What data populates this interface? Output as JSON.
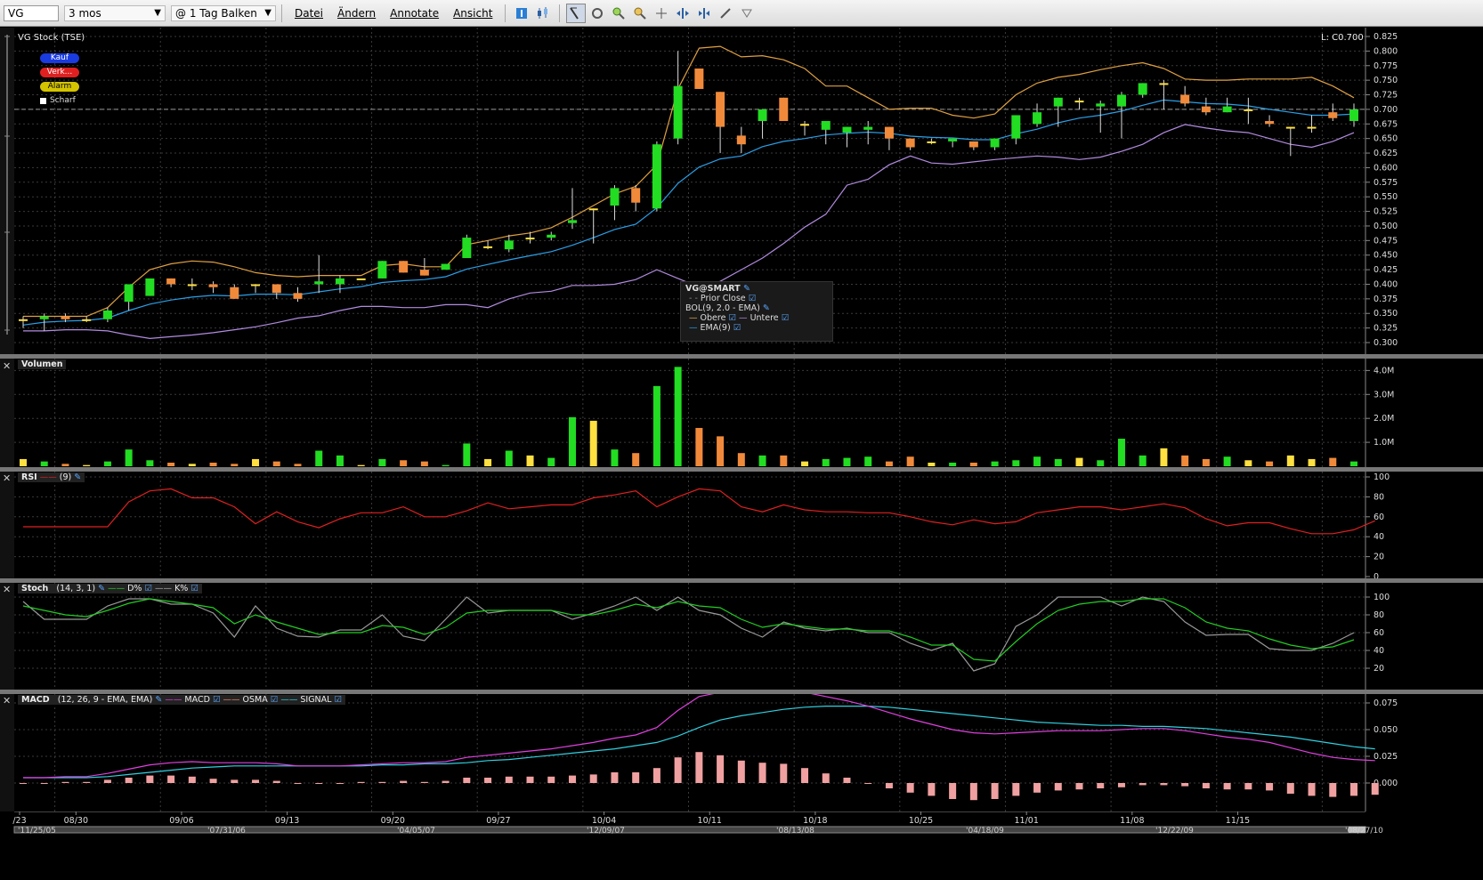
{
  "toolbar": {
    "symbol": "VG",
    "period": "3 mos",
    "bar_size": "@ 1 Tag Balken",
    "menus": [
      "Datei",
      "Ändern",
      "Annotate",
      "Ansicht"
    ]
  },
  "price_pane": {
    "title": "VG Stock (TSE)",
    "last_label": "L: C0.700",
    "buttons": {
      "buy": "Kauf",
      "sell": "Verk...",
      "alarm": "Alarm",
      "sharp": "Scharf"
    },
    "y_ticks": [
      "0.825",
      "0.800",
      "0.775",
      "0.750",
      "0.725",
      "0.700",
      "0.675",
      "0.650",
      "0.625",
      "0.600",
      "0.575",
      "0.550",
      "0.525",
      "0.500",
      "0.475",
      "0.450",
      "0.425",
      "0.400",
      "0.375",
      "0.350",
      "0.325",
      "0.300"
    ],
    "tooltip": {
      "header": "VG@SMART",
      "prior_close": "Prior Close",
      "bol": "BOL(9, 2.0 - EMA)",
      "upper": "Obere",
      "lower": "Untere",
      "ema": "EMA(9)"
    }
  },
  "volume_pane": {
    "title": "Volumen",
    "y_ticks": [
      "4.0M",
      "3.0M",
      "2.0M",
      "1.0M"
    ]
  },
  "rsi_pane": {
    "title": "RSI",
    "params": "(9)",
    "y_ticks": [
      "100",
      "80",
      "60",
      "40",
      "20",
      "0"
    ]
  },
  "stoch_pane": {
    "title": "Stoch",
    "params": "(14, 3, 1)",
    "d_label": "D%",
    "k_label": "K%",
    "y_ticks": [
      "100",
      "80",
      "60",
      "40",
      "20"
    ]
  },
  "macd_pane": {
    "title": "MACD",
    "params": "(12, 26, 9 - EMA, EMA)",
    "macd_label": "MACD",
    "osma_label": "OSMA",
    "signal_label": "SIGNAL",
    "y_ticks": [
      "0.075",
      "0.050",
      "0.025",
      "0.000"
    ]
  },
  "x_axis": {
    "dates": [
      "/23",
      "08/30",
      "09/06",
      "09/13",
      "09/20",
      "09/27",
      "10/04",
      "10/11",
      "10/18",
      "10/25",
      "11/01",
      "11/08",
      "11/15"
    ],
    "overview": [
      "11/25/05",
      "07/31/06",
      "04/05/07",
      "12/09/07",
      "08/13/08",
      "04/18/09",
      "12/22/09",
      "08/27/10"
    ]
  },
  "chart_data": {
    "type": "candlestick",
    "bars": [
      {
        "o": 0.34,
        "h": 0.345,
        "l": 0.325,
        "c": 0.34,
        "v": 0.3
      },
      {
        "o": 0.34,
        "h": 0.35,
        "l": 0.32,
        "c": 0.345,
        "v": 0.2
      },
      {
        "o": 0.345,
        "h": 0.35,
        "l": 0.335,
        "c": 0.34,
        "v": 0.1
      },
      {
        "o": 0.34,
        "h": 0.345,
        "l": 0.335,
        "c": 0.34,
        "v": 0.05
      },
      {
        "o": 0.34,
        "h": 0.36,
        "l": 0.335,
        "c": 0.355,
        "v": 0.2
      },
      {
        "o": 0.37,
        "h": 0.4,
        "l": 0.355,
        "c": 0.4,
        "v": 0.7
      },
      {
        "o": 0.38,
        "h": 0.41,
        "l": 0.38,
        "c": 0.41,
        "v": 0.25
      },
      {
        "o": 0.41,
        "h": 0.41,
        "l": 0.395,
        "c": 0.4,
        "v": 0.15
      },
      {
        "o": 0.4,
        "h": 0.41,
        "l": 0.39,
        "c": 0.4,
        "v": 0.1
      },
      {
        "o": 0.4,
        "h": 0.405,
        "l": 0.385,
        "c": 0.395,
        "v": 0.15
      },
      {
        "o": 0.395,
        "h": 0.4,
        "l": 0.375,
        "c": 0.375,
        "v": 0.1
      },
      {
        "o": 0.4,
        "h": 0.4,
        "l": 0.385,
        "c": 0.4,
        "v": 0.3
      },
      {
        "o": 0.4,
        "h": 0.4,
        "l": 0.375,
        "c": 0.385,
        "v": 0.2
      },
      {
        "o": 0.385,
        "h": 0.395,
        "l": 0.37,
        "c": 0.375,
        "v": 0.1
      },
      {
        "o": 0.4,
        "h": 0.45,
        "l": 0.385,
        "c": 0.405,
        "v": 0.65
      },
      {
        "o": 0.4,
        "h": 0.415,
        "l": 0.385,
        "c": 0.41,
        "v": 0.45
      },
      {
        "o": 0.41,
        "h": 0.41,
        "l": 0.41,
        "c": 0.41,
        "v": 0.05
      },
      {
        "o": 0.41,
        "h": 0.44,
        "l": 0.41,
        "c": 0.44,
        "v": 0.3
      },
      {
        "o": 0.44,
        "h": 0.44,
        "l": 0.42,
        "c": 0.42,
        "v": 0.25
      },
      {
        "o": 0.425,
        "h": 0.445,
        "l": 0.415,
        "c": 0.415,
        "v": 0.2
      },
      {
        "o": 0.425,
        "h": 0.435,
        "l": 0.425,
        "c": 0.435,
        "v": 0.05
      },
      {
        "o": 0.445,
        "h": 0.485,
        "l": 0.445,
        "c": 0.48,
        "v": 0.95
      },
      {
        "o": 0.465,
        "h": 0.475,
        "l": 0.46,
        "c": 0.465,
        "v": 0.3
      },
      {
        "o": 0.46,
        "h": 0.485,
        "l": 0.455,
        "c": 0.475,
        "v": 0.65
      },
      {
        "o": 0.48,
        "h": 0.49,
        "l": 0.47,
        "c": 0.48,
        "v": 0.45
      },
      {
        "o": 0.48,
        "h": 0.49,
        "l": 0.475,
        "c": 0.485,
        "v": 0.35
      },
      {
        "o": 0.505,
        "h": 0.565,
        "l": 0.495,
        "c": 0.51,
        "v": 2.05
      },
      {
        "o": 0.53,
        "h": 0.53,
        "l": 0.47,
        "c": 0.53,
        "v": 1.9
      },
      {
        "o": 0.535,
        "h": 0.57,
        "l": 0.51,
        "c": 0.565,
        "v": 0.7
      },
      {
        "o": 0.565,
        "h": 0.57,
        "l": 0.525,
        "c": 0.54,
        "v": 0.55
      },
      {
        "o": 0.53,
        "h": 0.645,
        "l": 0.525,
        "c": 0.64,
        "v": 3.35
      },
      {
        "o": 0.65,
        "h": 0.8,
        "l": 0.64,
        "c": 0.74,
        "v": 4.15
      },
      {
        "o": 0.77,
        "h": 0.77,
        "l": 0.735,
        "c": 0.735,
        "v": 1.6
      },
      {
        "o": 0.73,
        "h": 0.73,
        "l": 0.625,
        "c": 0.67,
        "v": 1.25
      },
      {
        "o": 0.655,
        "h": 0.67,
        "l": 0.625,
        "c": 0.64,
        "v": 0.55
      },
      {
        "o": 0.68,
        "h": 0.7,
        "l": 0.65,
        "c": 0.7,
        "v": 0.45
      },
      {
        "o": 0.72,
        "h": 0.72,
        "l": 0.68,
        "c": 0.68,
        "v": 0.45
      },
      {
        "o": 0.675,
        "h": 0.68,
        "l": 0.655,
        "c": 0.675,
        "v": 0.2
      },
      {
        "o": 0.665,
        "h": 0.68,
        "l": 0.64,
        "c": 0.68,
        "v": 0.3
      },
      {
        "o": 0.66,
        "h": 0.67,
        "l": 0.635,
        "c": 0.67,
        "v": 0.35
      },
      {
        "o": 0.665,
        "h": 0.68,
        "l": 0.64,
        "c": 0.67,
        "v": 0.4
      },
      {
        "o": 0.67,
        "h": 0.67,
        "l": 0.63,
        "c": 0.65,
        "v": 0.2
      },
      {
        "o": 0.65,
        "h": 0.65,
        "l": 0.63,
        "c": 0.635,
        "v": 0.4
      },
      {
        "o": 0.645,
        "h": 0.65,
        "l": 0.64,
        "c": 0.645,
        "v": 0.15
      },
      {
        "o": 0.645,
        "h": 0.65,
        "l": 0.635,
        "c": 0.65,
        "v": 0.15
      },
      {
        "o": 0.645,
        "h": 0.645,
        "l": 0.63,
        "c": 0.635,
        "v": 0.15
      },
      {
        "o": 0.635,
        "h": 0.65,
        "l": 0.63,
        "c": 0.65,
        "v": 0.2
      },
      {
        "o": 0.65,
        "h": 0.69,
        "l": 0.64,
        "c": 0.69,
        "v": 0.25
      },
      {
        "o": 0.675,
        "h": 0.71,
        "l": 0.67,
        "c": 0.695,
        "v": 0.4
      },
      {
        "o": 0.705,
        "h": 0.72,
        "l": 0.67,
        "c": 0.72,
        "v": 0.3
      },
      {
        "o": 0.715,
        "h": 0.72,
        "l": 0.7,
        "c": 0.715,
        "v": 0.35
      },
      {
        "o": 0.705,
        "h": 0.715,
        "l": 0.66,
        "c": 0.71,
        "v": 0.25
      },
      {
        "o": 0.705,
        "h": 0.73,
        "l": 0.65,
        "c": 0.725,
        "v": 1.15
      },
      {
        "o": 0.725,
        "h": 0.745,
        "l": 0.72,
        "c": 0.745,
        "v": 0.45
      },
      {
        "o": 0.745,
        "h": 0.75,
        "l": 0.7,
        "c": 0.745,
        "v": 0.75
      },
      {
        "o": 0.725,
        "h": 0.74,
        "l": 0.705,
        "c": 0.71,
        "v": 0.45
      },
      {
        "o": 0.705,
        "h": 0.72,
        "l": 0.69,
        "c": 0.695,
        "v": 0.3
      },
      {
        "o": 0.695,
        "h": 0.72,
        "l": 0.695,
        "c": 0.705,
        "v": 0.4
      },
      {
        "o": 0.7,
        "h": 0.72,
        "l": 0.675,
        "c": 0.7,
        "v": 0.25
      },
      {
        "o": 0.68,
        "h": 0.69,
        "l": 0.67,
        "c": 0.675,
        "v": 0.2
      },
      {
        "o": 0.67,
        "h": 0.67,
        "l": 0.62,
        "c": 0.67,
        "v": 0.45
      },
      {
        "o": 0.67,
        "h": 0.69,
        "l": 0.66,
        "c": 0.67,
        "v": 0.3
      },
      {
        "o": 0.695,
        "h": 0.71,
        "l": 0.68,
        "c": 0.685,
        "v": 0.35
      },
      {
        "o": 0.68,
        "h": 0.71,
        "l": 0.67,
        "c": 0.7,
        "v": 0.2
      }
    ],
    "ema": [
      0.33,
      0.335,
      0.337,
      0.338,
      0.342,
      0.355,
      0.366,
      0.373,
      0.378,
      0.381,
      0.38,
      0.383,
      0.383,
      0.382,
      0.387,
      0.392,
      0.396,
      0.403,
      0.406,
      0.408,
      0.413,
      0.426,
      0.434,
      0.442,
      0.449,
      0.456,
      0.467,
      0.48,
      0.494,
      0.503,
      0.531,
      0.573,
      0.601,
      0.615,
      0.62,
      0.636,
      0.645,
      0.65,
      0.656,
      0.659,
      0.661,
      0.659,
      0.654,
      0.652,
      0.651,
      0.648,
      0.648,
      0.658,
      0.666,
      0.677,
      0.685,
      0.69,
      0.697,
      0.707,
      0.716,
      0.713,
      0.71,
      0.709,
      0.706,
      0.7,
      0.695,
      0.69,
      0.69,
      0.692
    ],
    "bol_upper": [
      0.345,
      0.345,
      0.345,
      0.345,
      0.36,
      0.395,
      0.425,
      0.435,
      0.44,
      0.438,
      0.43,
      0.42,
      0.415,
      0.413,
      0.415,
      0.415,
      0.415,
      0.432,
      0.435,
      0.43,
      0.43,
      0.468,
      0.475,
      0.483,
      0.488,
      0.497,
      0.515,
      0.535,
      0.555,
      0.568,
      0.605,
      0.735,
      0.805,
      0.808,
      0.79,
      0.792,
      0.785,
      0.77,
      0.74,
      0.74,
      0.72,
      0.7,
      0.702,
      0.702,
      0.69,
      0.685,
      0.692,
      0.725,
      0.745,
      0.755,
      0.76,
      0.768,
      0.775,
      0.78,
      0.77,
      0.752,
      0.75,
      0.75,
      0.752,
      0.752,
      0.752,
      0.755,
      0.74,
      0.72
    ],
    "bol_lower": [
      0.32,
      0.32,
      0.322,
      0.322,
      0.32,
      0.313,
      0.307,
      0.31,
      0.313,
      0.317,
      0.322,
      0.327,
      0.334,
      0.342,
      0.346,
      0.355,
      0.362,
      0.362,
      0.36,
      0.36,
      0.365,
      0.365,
      0.36,
      0.375,
      0.385,
      0.388,
      0.398,
      0.398,
      0.4,
      0.408,
      0.425,
      0.41,
      0.395,
      0.405,
      0.425,
      0.445,
      0.47,
      0.498,
      0.52,
      0.57,
      0.58,
      0.605,
      0.62,
      0.608,
      0.606,
      0.61,
      0.614,
      0.617,
      0.62,
      0.618,
      0.614,
      0.618,
      0.628,
      0.64,
      0.66,
      0.674,
      0.668,
      0.663,
      0.66,
      0.65,
      0.64,
      0.635,
      0.645,
      0.66
    ],
    "rsi": [
      50,
      50,
      50,
      50,
      50,
      75,
      86,
      88,
      79,
      79,
      70,
      53,
      65,
      55,
      49,
      58,
      64,
      64,
      70,
      60,
      60,
      66,
      74,
      68,
      70,
      72,
      72,
      79,
      82,
      86,
      70,
      80,
      88,
      86,
      70,
      65,
      72,
      67,
      65,
      65,
      64,
      64,
      60,
      55,
      52,
      57,
      53,
      55,
      64,
      67,
      70,
      70,
      67,
      70,
      73,
      69,
      58,
      51,
      54,
      54,
      48,
      43,
      43,
      47,
      56
    ],
    "stoch_k": [
      95,
      75,
      75,
      75,
      90,
      98,
      98,
      92,
      92,
      82,
      55,
      90,
      65,
      56,
      55,
      63,
      63,
      80,
      56,
      51,
      75,
      100,
      82,
      85,
      85,
      85,
      75,
      82,
      90,
      100,
      85,
      100,
      85,
      80,
      65,
      55,
      72,
      65,
      62,
      65,
      60,
      60,
      48,
      40,
      48,
      17,
      25,
      67,
      80,
      100,
      100,
      100,
      90,
      100,
      95,
      72,
      57,
      58,
      58,
      42,
      40,
      40,
      48,
      60
    ],
    "stoch_d": [
      90,
      85,
      80,
      78,
      85,
      93,
      98,
      95,
      92,
      88,
      70,
      80,
      72,
      65,
      58,
      60,
      60,
      68,
      66,
      58,
      66,
      82,
      85,
      85,
      85,
      85,
      80,
      80,
      85,
      92,
      88,
      95,
      90,
      88,
      75,
      66,
      70,
      67,
      64,
      64,
      62,
      62,
      55,
      46,
      46,
      30,
      28,
      50,
      70,
      85,
      92,
      95,
      95,
      98,
      98,
      88,
      72,
      65,
      62,
      53,
      46,
      42,
      44,
      52
    ],
    "macd": [
      0.005,
      0.005,
      0.006,
      0.006,
      0.009,
      0.013,
      0.017,
      0.019,
      0.02,
      0.019,
      0.019,
      0.019,
      0.018,
      0.016,
      0.016,
      0.016,
      0.017,
      0.018,
      0.019,
      0.019,
      0.02,
      0.024,
      0.026,
      0.028,
      0.03,
      0.032,
      0.035,
      0.038,
      0.042,
      0.045,
      0.052,
      0.068,
      0.081,
      0.085,
      0.084,
      0.085,
      0.087,
      0.085,
      0.081,
      0.077,
      0.072,
      0.066,
      0.06,
      0.055,
      0.05,
      0.047,
      0.046,
      0.047,
      0.048,
      0.049,
      0.049,
      0.049,
      0.05,
      0.051,
      0.051,
      0.049,
      0.046,
      0.043,
      0.041,
      0.038,
      0.033,
      0.028,
      0.024,
      0.022,
      0.021
    ],
    "signal": [
      0.005,
      0.005,
      0.005,
      0.005,
      0.006,
      0.008,
      0.01,
      0.012,
      0.014,
      0.015,
      0.016,
      0.016,
      0.016,
      0.016,
      0.016,
      0.016,
      0.016,
      0.017,
      0.017,
      0.018,
      0.018,
      0.019,
      0.021,
      0.022,
      0.024,
      0.026,
      0.028,
      0.03,
      0.032,
      0.035,
      0.038,
      0.044,
      0.052,
      0.059,
      0.063,
      0.066,
      0.069,
      0.071,
      0.072,
      0.072,
      0.072,
      0.071,
      0.069,
      0.067,
      0.065,
      0.063,
      0.061,
      0.059,
      0.057,
      0.056,
      0.055,
      0.054,
      0.054,
      0.053,
      0.053,
      0.052,
      0.051,
      0.049,
      0.047,
      0.045,
      0.043,
      0.04,
      0.037,
      0.034,
      0.032
    ],
    "osma": [
      0.0,
      0.0,
      0.001,
      0.001,
      0.003,
      0.005,
      0.007,
      0.007,
      0.006,
      0.004,
      0.003,
      0.003,
      0.002,
      0.0,
      0.0,
      0.0,
      0.001,
      0.001,
      0.002,
      0.001,
      0.002,
      0.005,
      0.005,
      0.006,
      0.006,
      0.006,
      0.007,
      0.008,
      0.01,
      0.01,
      0.014,
      0.024,
      0.029,
      0.026,
      0.021,
      0.019,
      0.018,
      0.014,
      0.009,
      0.005,
      0.0,
      -0.005,
      -0.009,
      -0.012,
      -0.015,
      -0.016,
      -0.015,
      -0.012,
      -0.009,
      -0.007,
      -0.006,
      -0.005,
      -0.004,
      -0.002,
      -0.002,
      -0.003,
      -0.005,
      -0.006,
      -0.006,
      -0.007,
      -0.01,
      -0.012,
      -0.013,
      -0.012,
      -0.011
    ]
  }
}
